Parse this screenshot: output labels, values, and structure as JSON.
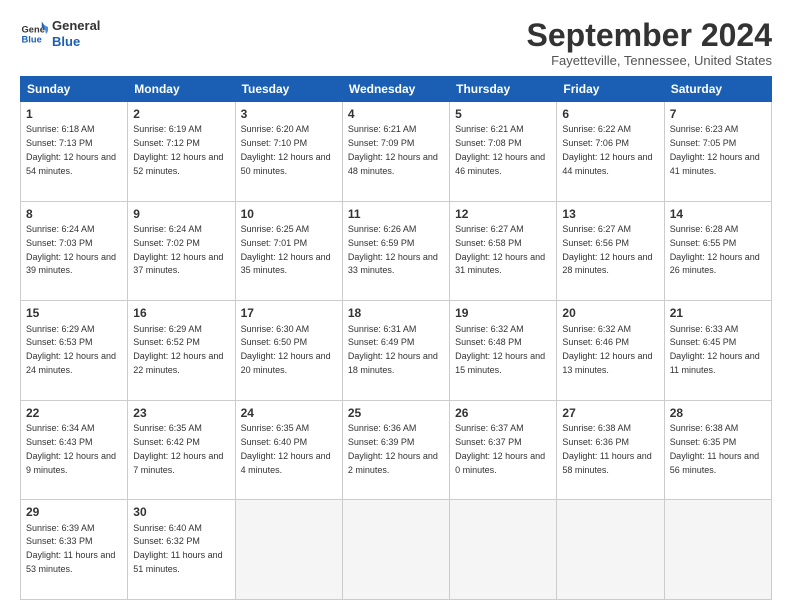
{
  "logo": {
    "line1": "General",
    "line2": "Blue"
  },
  "header": {
    "month": "September 2024",
    "location": "Fayetteville, Tennessee, United States"
  },
  "weekdays": [
    "Sunday",
    "Monday",
    "Tuesday",
    "Wednesday",
    "Thursday",
    "Friday",
    "Saturday"
  ],
  "weeks": [
    [
      {
        "day": "1",
        "sunrise": "6:18 AM",
        "sunset": "7:13 PM",
        "daylight": "12 hours and 54 minutes."
      },
      {
        "day": "2",
        "sunrise": "6:19 AM",
        "sunset": "7:12 PM",
        "daylight": "12 hours and 52 minutes."
      },
      {
        "day": "3",
        "sunrise": "6:20 AM",
        "sunset": "7:10 PM",
        "daylight": "12 hours and 50 minutes."
      },
      {
        "day": "4",
        "sunrise": "6:21 AM",
        "sunset": "7:09 PM",
        "daylight": "12 hours and 48 minutes."
      },
      {
        "day": "5",
        "sunrise": "6:21 AM",
        "sunset": "7:08 PM",
        "daylight": "12 hours and 46 minutes."
      },
      {
        "day": "6",
        "sunrise": "6:22 AM",
        "sunset": "7:06 PM",
        "daylight": "12 hours and 44 minutes."
      },
      {
        "day": "7",
        "sunrise": "6:23 AM",
        "sunset": "7:05 PM",
        "daylight": "12 hours and 41 minutes."
      }
    ],
    [
      {
        "day": "8",
        "sunrise": "6:24 AM",
        "sunset": "7:03 PM",
        "daylight": "12 hours and 39 minutes."
      },
      {
        "day": "9",
        "sunrise": "6:24 AM",
        "sunset": "7:02 PM",
        "daylight": "12 hours and 37 minutes."
      },
      {
        "day": "10",
        "sunrise": "6:25 AM",
        "sunset": "7:01 PM",
        "daylight": "12 hours and 35 minutes."
      },
      {
        "day": "11",
        "sunrise": "6:26 AM",
        "sunset": "6:59 PM",
        "daylight": "12 hours and 33 minutes."
      },
      {
        "day": "12",
        "sunrise": "6:27 AM",
        "sunset": "6:58 PM",
        "daylight": "12 hours and 31 minutes."
      },
      {
        "day": "13",
        "sunrise": "6:27 AM",
        "sunset": "6:56 PM",
        "daylight": "12 hours and 28 minutes."
      },
      {
        "day": "14",
        "sunrise": "6:28 AM",
        "sunset": "6:55 PM",
        "daylight": "12 hours and 26 minutes."
      }
    ],
    [
      {
        "day": "15",
        "sunrise": "6:29 AM",
        "sunset": "6:53 PM",
        "daylight": "12 hours and 24 minutes."
      },
      {
        "day": "16",
        "sunrise": "6:29 AM",
        "sunset": "6:52 PM",
        "daylight": "12 hours and 22 minutes."
      },
      {
        "day": "17",
        "sunrise": "6:30 AM",
        "sunset": "6:50 PM",
        "daylight": "12 hours and 20 minutes."
      },
      {
        "day": "18",
        "sunrise": "6:31 AM",
        "sunset": "6:49 PM",
        "daylight": "12 hours and 18 minutes."
      },
      {
        "day": "19",
        "sunrise": "6:32 AM",
        "sunset": "6:48 PM",
        "daylight": "12 hours and 15 minutes."
      },
      {
        "day": "20",
        "sunrise": "6:32 AM",
        "sunset": "6:46 PM",
        "daylight": "12 hours and 13 minutes."
      },
      {
        "day": "21",
        "sunrise": "6:33 AM",
        "sunset": "6:45 PM",
        "daylight": "12 hours and 11 minutes."
      }
    ],
    [
      {
        "day": "22",
        "sunrise": "6:34 AM",
        "sunset": "6:43 PM",
        "daylight": "12 hours and 9 minutes."
      },
      {
        "day": "23",
        "sunrise": "6:35 AM",
        "sunset": "6:42 PM",
        "daylight": "12 hours and 7 minutes."
      },
      {
        "day": "24",
        "sunrise": "6:35 AM",
        "sunset": "6:40 PM",
        "daylight": "12 hours and 4 minutes."
      },
      {
        "day": "25",
        "sunrise": "6:36 AM",
        "sunset": "6:39 PM",
        "daylight": "12 hours and 2 minutes."
      },
      {
        "day": "26",
        "sunrise": "6:37 AM",
        "sunset": "6:37 PM",
        "daylight": "12 hours and 0 minutes."
      },
      {
        "day": "27",
        "sunrise": "6:38 AM",
        "sunset": "6:36 PM",
        "daylight": "11 hours and 58 minutes."
      },
      {
        "day": "28",
        "sunrise": "6:38 AM",
        "sunset": "6:35 PM",
        "daylight": "11 hours and 56 minutes."
      }
    ],
    [
      {
        "day": "29",
        "sunrise": "6:39 AM",
        "sunset": "6:33 PM",
        "daylight": "11 hours and 53 minutes."
      },
      {
        "day": "30",
        "sunrise": "6:40 AM",
        "sunset": "6:32 PM",
        "daylight": "11 hours and 51 minutes."
      },
      null,
      null,
      null,
      null,
      null
    ]
  ]
}
